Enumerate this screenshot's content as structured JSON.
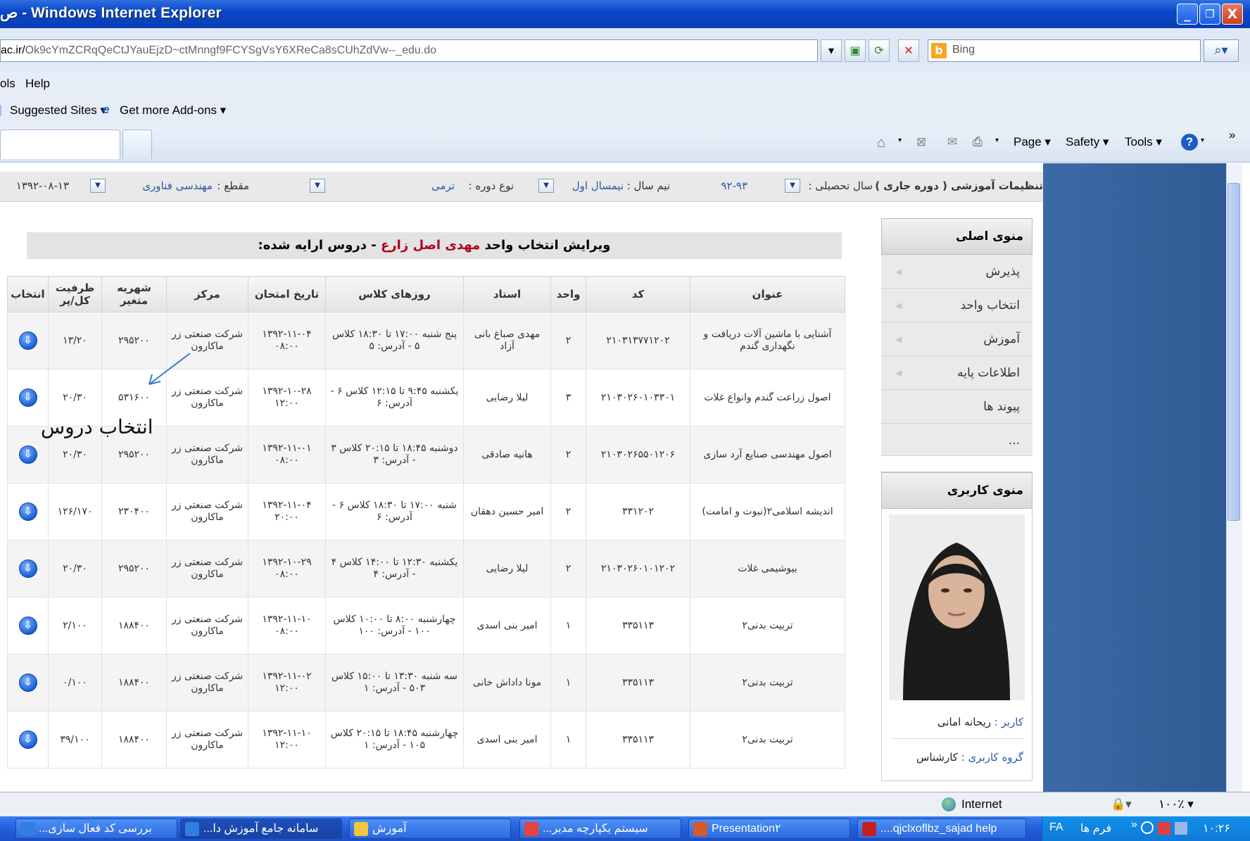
{
  "window": {
    "title": "ص - Windows Internet Explorer",
    "min_glyph": "_",
    "max_glyph": "❐",
    "close_glyph": "X"
  },
  "address": {
    "url_host": "ac.ir/",
    "url_path": "Ok9cYmZCRqQeCtJYauEjzD~ctMnngf9FCYSgVsY6XReCa8sCUhZdVw--_edu.do",
    "search_placeholder": "Bing"
  },
  "menu": {
    "tools": "ols",
    "help": "Help"
  },
  "favorites": {
    "suggested": "Suggested Sites ▾",
    "addons": "Get more Add-ons ▾"
  },
  "command_bar": {
    "page": "Page ▾",
    "safety": "Safety ▾",
    "tools": "Tools ▾",
    "help_icon": "?",
    "more": "»"
  },
  "settings": {
    "label": "تنظیمات آموزشی ( دوره جاری )",
    "year_label": "سال تحصیلی :",
    "year_value": "۹۲-۹۳",
    "term_label": "نیم سال :",
    "term_value": "نیمسال اول",
    "course_type_label": "نوع دوره :",
    "course_type_value": "ترمی",
    "level_label": "مقطع :",
    "level_value": "مهندسی فناوری",
    "date_value": "۱۳۹۲-۰۸-۱۳"
  },
  "sidebar": {
    "main_menu_title": "منوی اصلی",
    "items": [
      "پذیرش",
      "انتخاب واحد",
      "آموزش",
      "اطلاعات پایه",
      "پیوند ها",
      "..."
    ],
    "user_menu_title": "منوی کاربری",
    "user_label": "کاربر :",
    "user_name": "ریحانه امانی",
    "group_label": "گروه کاربری :",
    "group_name": "کارشناس"
  },
  "page": {
    "title_prefix": "ویرایش انتخاب واحد",
    "student_name": "مهدی اصل زارع",
    "title_suffix": "- دروس ارایه شده:",
    "annotation": "انتخاب دروس"
  },
  "table": {
    "headers": [
      "عنوان",
      "کد",
      "واحد",
      "استاد",
      "روزهای کلاس",
      "تاریخ امتحان",
      "مرکز",
      "شهریه متغیر",
      "ظرفیت کل/پر",
      "انتخاب"
    ],
    "rows": [
      [
        "آشنایی با ماشین آلات دریافت و نگهداری گندم",
        "۲۱۰۳۱۳۷۷۱۲۰۲",
        "۲",
        "مهدی صباغ بانی آزاد",
        "پنج شنبه ۱۷:۰۰ تا ۱۸:۳۰ کلاس ۵ - آدرس: ۵",
        "۱۳۹۲-۱۱-۰۴ ۰۸:۰۰",
        "شرکت صنعتی زر ماکارون",
        "۲۹۵۲۰۰",
        "۱۳/۲۰",
        "⇩"
      ],
      [
        "اصول زراعت گندم وانواع غلات",
        "۲۱۰۳۰۲۶۰۱۰۳۳۰۱",
        "۳",
        "لیلا رضایی",
        "یکشنبه ۹:۴۵ تا ۱۲:۱۵ کلاس ۶ - آدرس: ۶",
        "۱۳۹۲-۱۰-۲۸ ۱۲:۰۰",
        "شرکت صنعتی زر ماکارون",
        "۵۳۱۶۰۰",
        "۲۰/۳۰",
        "⇩"
      ],
      [
        "اصول مهندسی صنایع آرد سازی",
        "۲۱۰۳۰۲۶۵۵۰۱۲۰۶",
        "۲",
        "هانیه صادقی",
        "دوشنبه ۱۸:۴۵ تا ۲۰:۱۵ کلاس ۳ - آدرس: ۳",
        "۱۳۹۲-۱۱-۰۱ ۰۸:۰۰",
        "شرکت صنعتی زر ماکارون",
        "۲۹۵۲۰۰",
        "۲۰/۳۰",
        "⇩"
      ],
      [
        "اندیشه اسلامی۲(نبوت و امامت)",
        "۳۳۱۲۰۲",
        "۲",
        "امیر حسین دهقان",
        "شنبه ۱۷:۰۰ تا ۱۸:۳۰ کلاس ۶ - آدرس: ۶",
        "۱۳۹۲-۱۱-۰۴ ۲۰:۰۰",
        "شرکت صنعتی زر ماکارون",
        "۲۳۰۴۰۰",
        "۱۲۶/۱۷۰",
        "⇩"
      ],
      [
        "بیوشیمی غلات",
        "۲۱۰۳۰۲۶۰۱۰۱۲۰۲",
        "۲",
        "لیلا رضایی",
        "یکشنبه ۱۲:۳۰ تا ۱۴:۰۰ کلاس ۴ - آدرس: ۴",
        "۱۳۹۲-۱۰-۲۹ ۰۸:۰۰",
        "شرکت صنعتی زر ماکارون",
        "۲۹۵۲۰۰",
        "۲۰/۳۰",
        "⇩"
      ],
      [
        "تربیت بدنی۲",
        "۳۳۵۱۱۳",
        "۱",
        "امیر بنی اسدی",
        "چهارشنبه ۸:۰۰ تا ۱۰:۰۰ کلاس ۱۰۰ - آدرس: ۱۰۰",
        "۱۳۹۲-۱۱-۱۰ ۰۸:۰۰",
        "شرکت صنعتی زر ماکارون",
        "۱۸۸۴۰۰",
        "۲/۱۰۰",
        "⇩"
      ],
      [
        "تربیت بدنی۲",
        "۳۳۵۱۱۳",
        "۱",
        "مونا داداش خانی",
        "سه شنبه ۱۳:۳۰ تا ۱۵:۰۰ کلاس ۵۰۳ - آدرس: ۱",
        "۱۳۹۲-۱۱-۰۲ ۱۲:۰۰",
        "شرکت صنعتی زر ماکارون",
        "۱۸۸۴۰۰",
        "۰/۱۰۰",
        "⇩"
      ],
      [
        "تربیت بدنی۲",
        "۳۳۵۱۱۳",
        "۱",
        "امیر بنی اسدی",
        "چهارشنبه ۱۸:۴۵ تا ۲۰:۱۵ کلاس ۱۰۵ - آدرس: ۱",
        "۱۳۹۲-۱۱-۱۰ ۱۲:۰۰",
        "شرکت صنعتی زر ماکارون",
        "۱۸۸۴۰۰",
        "۳۹/۱۰۰",
        "⇩"
      ]
    ]
  },
  "status": {
    "zone": "Internet",
    "zoom": "۱۰۰٪ ▾"
  },
  "taskbar": {
    "tasks": [
      "بررسی کد فعال سازی...",
      "سامانه جامع آموزش دا...",
      "آموزش",
      "سیستم یکپارچه مدیر...",
      "Presentation۲",
      "qjclxoflbz_sajad help...."
    ],
    "lang": "FA",
    "toolbar_label": "فرم ها",
    "clock": "۱۰:۲۶"
  }
}
